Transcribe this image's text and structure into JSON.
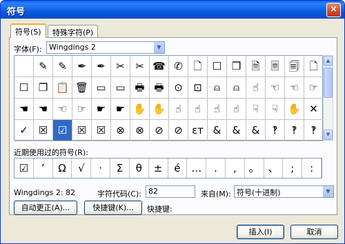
{
  "window": {
    "title": "符号",
    "close_glyph": "×"
  },
  "tabs": [
    {
      "label": "符号(S)",
      "active": true
    },
    {
      "label": "特殊字符(P)",
      "active": false
    }
  ],
  "font": {
    "label": "字体(F):",
    "value": "Wingdings 2"
  },
  "symbol_grid": [
    [
      "",
      "✎",
      "✎",
      "✒",
      "✒",
      "✂",
      "✂",
      "☎",
      "✆",
      "🗋",
      "☐",
      "❐",
      "🗎",
      "🗏",
      "🗐",
      "🗋"
    ],
    [
      "☐",
      "❐",
      "📋",
      "🗑",
      "▭",
      "▭",
      "🖶",
      "🖶",
      "⊙",
      "⊡",
      "⍝",
      "⍝",
      "☝",
      "☜",
      "☜",
      "☞"
    ],
    [
      "☚",
      "☚",
      "☜",
      "☞",
      "☛",
      "☛",
      "✋",
      "✋",
      "☝",
      "☝",
      "☝",
      "☝",
      "☟",
      "☟",
      "✋",
      "✕"
    ],
    [
      "✓",
      "☒",
      "☑",
      "☒",
      "☒",
      "⊗",
      "⊗",
      "⊘",
      "⊘",
      "ɛт",
      "&",
      "&",
      "&",
      "‽",
      "‽",
      "‽"
    ]
  ],
  "selected_cell": {
    "row": 3,
    "col": 2
  },
  "recent": {
    "label": "近期使用过的符号(R):",
    "symbols": [
      "☑",
      "’",
      "Ω",
      "√",
      "·",
      "Σ",
      "θ",
      "±",
      "é",
      "…",
      ".",
      ",",
      "。",
      "、",
      ";",
      ":"
    ]
  },
  "char_info": {
    "name": "Wingdings 2: 82",
    "code_label": "字符代码(C):",
    "code_value": "82",
    "from_label": "来自(M):",
    "from_value": "符号(十进制)"
  },
  "buttons": {
    "autocorrect": "自动更正(A)...",
    "shortcut_key": "快捷键(K)...",
    "shortcut_label": "快捷键:",
    "insert": "插入(I)",
    "cancel": "取消"
  }
}
